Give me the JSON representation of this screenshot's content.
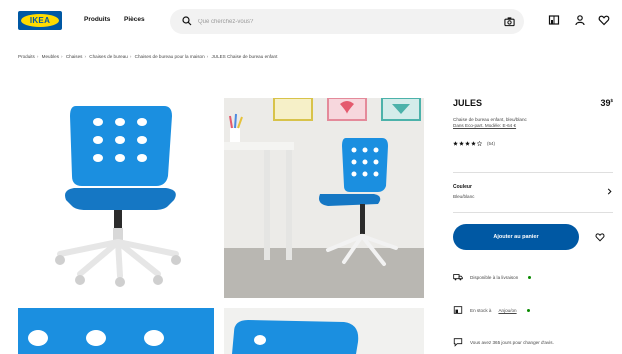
{
  "header": {
    "logo_text": "IKEA",
    "nav": [
      "Produits",
      "Pièces"
    ],
    "search_placeholder": "Que cherchez-vous?",
    "icons": [
      "search-icon",
      "camera-icon",
      "store-icon",
      "user-icon",
      "heart-icon"
    ]
  },
  "breadcrumb": [
    "Produits",
    "Meubles",
    "Chaises",
    "Chaises de bureau",
    "Chaises de bureau pour la maison",
    "JULES Chaise de bureau enfant"
  ],
  "product": {
    "name": "JULES",
    "price": "39",
    "price_suffix": "$",
    "description_line1": "Chaise de bureau enfant, bleu/blanc",
    "description_line2": "Dans Eco-part. Modèle: E-64 €",
    "rating": {
      "stars": 4,
      "count": "(54)"
    },
    "color_label": "Couleur",
    "color_value": "Bleu/blanc",
    "add_to_cart_label": "Ajouter au panier"
  },
  "availability": {
    "delivery": "Disponible à la livraison",
    "store_prefix": "En stock à",
    "store_name": "Anjou/on",
    "returns": "Vous avez 365 jours pour changer d'avis."
  },
  "colors": {
    "brand_blue": "#0058a3",
    "brand_yellow": "#ffdb00",
    "chair_blue": "#1b8fe0",
    "in_stock_green": "#0a8a00"
  }
}
